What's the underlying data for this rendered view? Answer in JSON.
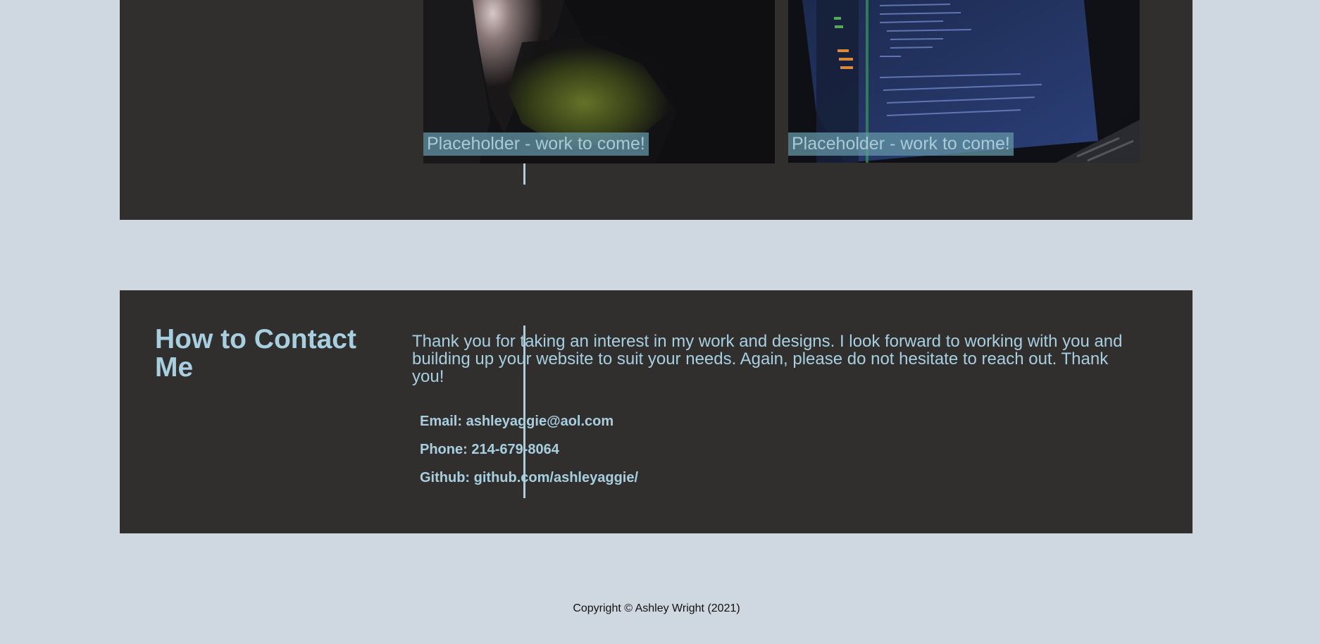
{
  "work": {
    "cards": [
      {
        "caption": "Placeholder - work to come!",
        "image": "cave-opening-photo"
      },
      {
        "caption": "Placeholder - work to come!",
        "image": "code-editor-laptop-photo"
      }
    ]
  },
  "contact": {
    "title": "How to Contact Me",
    "intro": "Thank you for taking an interest in my work and designs. I look forward to working with you and building up your website to suit your needs. Again, please do not hesitate to reach out. Thank you!",
    "email": "Email: ashleyaggie@aol.com",
    "phone": "Phone: 214-679-8064",
    "github": "Github: github.com/ashleyaggie/"
  },
  "footer": {
    "copyright": "Copyright © Ashley Wright (2021)"
  },
  "colors": {
    "page_background": "#cfd7e1",
    "panel_background": "#302f2e",
    "accent": "#a8cfe0",
    "caption_background": "#6394a6"
  }
}
